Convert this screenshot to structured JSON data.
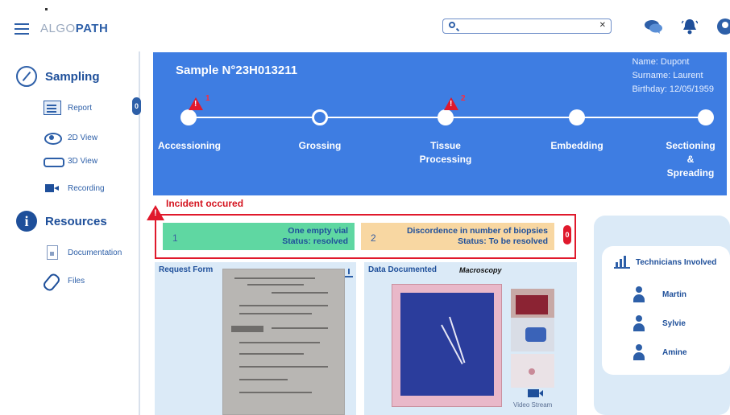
{
  "app": {
    "logo_left": "ALGO",
    "logo_right": "PATH"
  },
  "search": {
    "value": "",
    "placeholder": ""
  },
  "icons": {
    "menu": "hamburger-icon",
    "search": "search-icon",
    "clear": "close-icon",
    "chat": "chat-icon",
    "notifications": "bell-icon",
    "profile": "user-icon"
  },
  "sidebar": {
    "sampling": {
      "title": "Sampling",
      "items": [
        {
          "label": "Report",
          "icon": "report-icon",
          "badge": "0"
        },
        {
          "label": "2D View",
          "icon": "eye-icon"
        },
        {
          "label": "3D View",
          "icon": "3d-glasses-icon"
        },
        {
          "label": "Recording",
          "icon": "video-camera-icon"
        }
      ]
    },
    "resources": {
      "title": "Resources",
      "items": [
        {
          "label": "Documentation",
          "icon": "document-icon"
        },
        {
          "label": "Files",
          "icon": "paperclip-icon"
        }
      ]
    }
  },
  "sample": {
    "title": "Sample N°23H013211",
    "patient": {
      "name": "Name: Dupont",
      "surname": "Surname: Laurent",
      "birthday": "Birthday: 12/05/1959"
    }
  },
  "workflow": {
    "steps": [
      {
        "label": "Accessioning",
        "warning": "1",
        "state": "done"
      },
      {
        "label": "Grossing",
        "state": "current"
      },
      {
        "label": "Tissue Processing",
        "line1": "Tissue",
        "line2": "Processing",
        "warning": "2",
        "state": "done"
      },
      {
        "label": "Embedding",
        "state": "done"
      },
      {
        "label": "Sectioning & Spreading",
        "line1": "Sectioning",
        "line2": "&",
        "line3": "Spreading",
        "state": "done"
      }
    ]
  },
  "incidents": {
    "title": "Incident occured",
    "badge": "0",
    "items": [
      {
        "number": "1",
        "title": "One empty vial",
        "status": "Status: resolved"
      },
      {
        "number": "2",
        "title": "Discordence in number of biopsies",
        "status": "Status: To be resolved"
      }
    ]
  },
  "panels": {
    "request_form": {
      "title": "Request Form"
    },
    "data_documented": {
      "title": "Data Documented",
      "subtitle": "Macroscopy",
      "video_label": "Video Stream"
    }
  },
  "technicians": {
    "title": "Technicians Involved",
    "people": [
      "Martin",
      "Sylvie",
      "Amine"
    ]
  },
  "colors": {
    "primary": "#3e7de2",
    "dark_blue": "#1e4f9a",
    "alert_red": "#e0192c",
    "resolved_green": "#5fd7a2",
    "pending_orange": "#f8d7a2",
    "panel_bg": "#dbeaf7"
  }
}
